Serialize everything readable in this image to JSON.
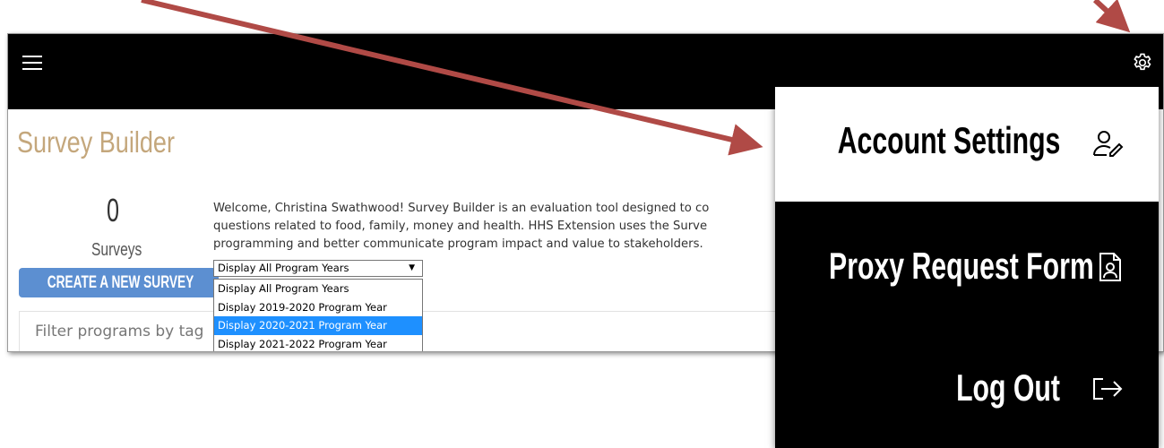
{
  "header": {
    "menu_icon": "hamburger-menu-icon",
    "settings_icon": "gear-icon"
  },
  "page": {
    "title": "Survey Builder",
    "survey_count": "0",
    "survey_count_label": "Surveys",
    "create_button": "CREATE A NEW SURVEY",
    "welcome_lines": [
      "Welcome, Christina Swathwood! Survey Builder is an evaluation tool designed to co",
      "questions related to food, family, money and health. HHS Extension uses the Surve",
      "programming and better communicate program impact and value to stakeholders."
    ],
    "filter_placeholder": "Filter programs by tag"
  },
  "program_year_select": {
    "selected": "Display All Program Years",
    "options": [
      "Display All Program Years",
      "Display 2019-2020 Program Year",
      "Display 2020-2021 Program Year",
      "Display 2021-2022 Program Year"
    ],
    "highlighted_index": 2
  },
  "settings_menu": {
    "items": [
      {
        "label": "Account Settings",
        "icon": "user-edit-icon"
      },
      {
        "label": "Proxy Request Form",
        "icon": "user-document-icon"
      },
      {
        "label": "Log Out",
        "icon": "logout-arrow-icon"
      }
    ]
  },
  "colors": {
    "title": "#c4a77c",
    "topbar": "#000000",
    "button": "#5c8fd1",
    "option_highlight": "#1e90ff",
    "annotation_arrow": "#b04a46"
  }
}
